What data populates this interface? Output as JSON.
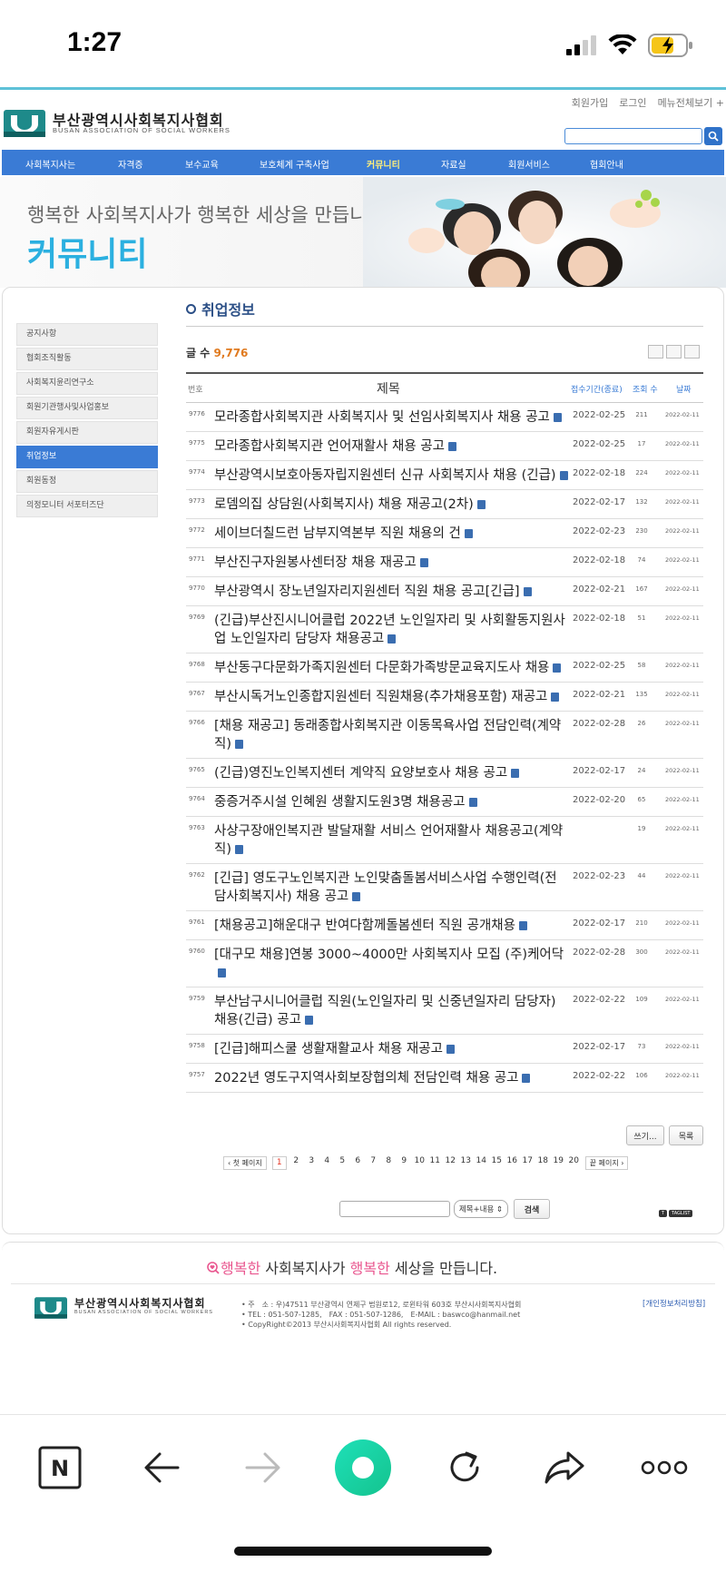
{
  "status": {
    "time": "1:27"
  },
  "header": {
    "logo_text": "부산광역시사회복지사협회",
    "logo_sub": "BUSAN ASSOCIATION OF SOCIAL WORKERS",
    "util_links": [
      "회원가입",
      "로그인",
      "메뉴전체보기 +"
    ],
    "search_value": ""
  },
  "gnb": [
    "사회복지사는",
    "자격증",
    "보수교육",
    "보호체계 구축사업",
    "커뮤니티",
    "자료실",
    "회원서비스",
    "협회안내"
  ],
  "banner": {
    "slogan": "행복한 사회복지사가 행복한 세상을 만듭니다.",
    "title": "커뮤니티"
  },
  "lnb": [
    "공지사항",
    "협회조직활동",
    "사회복지윤리연구소",
    "회원기관행사및사업홍보",
    "회원자유게시판",
    "취업정보",
    "회원동정",
    "의정모니터 서포터즈단"
  ],
  "board": {
    "title": "취업정보",
    "count_label": "글 수",
    "count": "9,776",
    "columns": {
      "no": "번호",
      "title": "제목",
      "date": "접수기간(종료)",
      "views": "조회 수",
      "reg": "날짜"
    },
    "rows": [
      {
        "no": "9776",
        "title": "모라종합사회복지관 사회복지사 및 선임사회복지사 채용 공고",
        "date": "2022-02-25",
        "views": "211",
        "reg": "2022-02-11"
      },
      {
        "no": "9775",
        "title": "모라종합사회복지관 언어재활사 채용 공고",
        "date": "2022-02-25",
        "views": "17",
        "reg": "2022-02-11"
      },
      {
        "no": "9774",
        "title": "부산광역시보호아동자립지원센터 신규 사회복지사 채용 (긴급)",
        "date": "2022-02-18",
        "views": "224",
        "reg": "2022-02-11"
      },
      {
        "no": "9773",
        "title": "로뎀의집 상담원(사회복지사) 채용 재공고(2차)",
        "date": "2022-02-17",
        "views": "132",
        "reg": "2022-02-11"
      },
      {
        "no": "9772",
        "title": "세이브더칠드런 남부지역본부 직원 채용의 건",
        "date": "2022-02-23",
        "views": "230",
        "reg": "2022-02-11"
      },
      {
        "no": "9771",
        "title": "부산진구자원봉사센터장 채용 재공고",
        "date": "2022-02-18",
        "views": "74",
        "reg": "2022-02-11"
      },
      {
        "no": "9770",
        "title": "부산광역시 장노년일자리지원센터 직원 채용 공고[긴급]",
        "date": "2022-02-21",
        "views": "167",
        "reg": "2022-02-11"
      },
      {
        "no": "9769",
        "title": "(긴급)부산진시니어클럽 2022년 노인일자리 및 사회활동지원사업 노인일자리 담당자 채용공고",
        "date": "2022-02-18",
        "views": "51",
        "reg": "2022-02-11"
      },
      {
        "no": "9768",
        "title": "부산동구다문화가족지원센터 다문화가족방문교육지도사 채용",
        "date": "2022-02-25",
        "views": "58",
        "reg": "2022-02-11"
      },
      {
        "no": "9767",
        "title": "부산시독거노인종합지원센터 직원채용(추가채용포함) 재공고",
        "date": "2022-02-21",
        "views": "135",
        "reg": "2022-02-11"
      },
      {
        "no": "9766",
        "title": "[채용 재공고] 동래종합사회복지관 이동목욕사업 전담인력(계약직)",
        "date": "2022-02-28",
        "views": "26",
        "reg": "2022-02-11"
      },
      {
        "no": "9765",
        "title": "(긴급)영진노인복지센터 계약직 요양보호사 채용 공고",
        "date": "2022-02-17",
        "views": "24",
        "reg": "2022-02-11"
      },
      {
        "no": "9764",
        "title": "중증거주시설 인혜원 생활지도원3명 채용공고",
        "date": "2022-02-20",
        "views": "65",
        "reg": "2022-02-11"
      },
      {
        "no": "9763",
        "title": "사상구장애인복지관 발달재활 서비스 언어재활사 채용공고(계약직)",
        "date": "",
        "views": "19",
        "reg": "2022-02-11"
      },
      {
        "no": "9762",
        "title": "[긴급] 영도구노인복지관 노인맞춤돌봄서비스사업 수행인력(전담사회복지사) 채용 공고",
        "date": "2022-02-23",
        "views": "44",
        "reg": "2022-02-11"
      },
      {
        "no": "9761",
        "title": "[채용공고]해운대구 반여다함께돌봄센터 직원 공개채용",
        "date": "2022-02-17",
        "views": "210",
        "reg": "2022-02-11"
      },
      {
        "no": "9760",
        "title": "[대구모 채용]연봉 3000~4000만 사회복지사 모집 (주)케어닥",
        "date": "2022-02-28",
        "views": "300",
        "reg": "2022-02-11"
      },
      {
        "no": "9759",
        "title": "부산남구시니어클럽 직원(노인일자리 및 신중년일자리 담당자) 채용(긴급) 공고",
        "date": "2022-02-22",
        "views": "109",
        "reg": "2022-02-11"
      },
      {
        "no": "9758",
        "title": "[긴급]해피스쿨 생활재활교사 채용 재공고",
        "date": "2022-02-17",
        "views": "73",
        "reg": "2022-02-11"
      },
      {
        "no": "9757",
        "title": "2022년 영도구지역사회보장협의체 전담인력 채용 공고",
        "date": "2022-02-22",
        "views": "106",
        "reg": "2022-02-11"
      }
    ],
    "write_label": "쓰기...",
    "list_label": "목록"
  },
  "pager": {
    "first": "‹ 첫 페이지",
    "pages": [
      "1",
      "2",
      "3",
      "4",
      "5",
      "6",
      "7",
      "8",
      "9",
      "10",
      "11",
      "12",
      "13",
      "14",
      "15",
      "16",
      "17",
      "18",
      "19",
      "20"
    ],
    "current": "1",
    "last": "끝 페이지 ›"
  },
  "search": {
    "select": "제목+내용 ⇕",
    "button": "검색",
    "tags": [
      "T",
      "TAGLIST"
    ]
  },
  "footer": {
    "slogan_pre": "행복한",
    "slogan_mid": " 사회복지사가 ",
    "slogan_pink2": "행복한",
    "slogan_post": " 세상을 만듭니다.",
    "logo_text": "부산광역시사회복지사협회",
    "logo_sub": "BUSAN ASSOCIATION OF SOCIAL WORKERS",
    "address": "• 주　소 : 우)47511 부산광역시 연제구 법원로12, 로윈타워 603호 부산시사회복지사협회",
    "contact": "• TEL : 051-507-1285,　FAX : 051-507-1286,　E-MAIL : baswco@hanmail.net",
    "copyright": "• CopyRight©2013 부산시사회복지사협회 All rights reserved.",
    "privacy": "[개인정보처리방침]"
  },
  "browser": {
    "logo": "N"
  },
  "colors": {
    "nav": "#3a7bd5",
    "accent": "#2bb0e0",
    "count": "#e07a1f",
    "pink": "#e9568f"
  }
}
